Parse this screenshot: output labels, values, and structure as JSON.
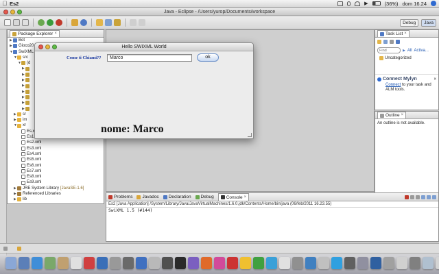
{
  "menubar": {
    "app_name": "Es2",
    "battery_text": "(36%)",
    "clock": "dom 16.24"
  },
  "window": {
    "title": "Java - Eclipse - /Users/yurop/Documents/workspace"
  },
  "toolbar": {
    "perspectives": [
      "Debug",
      "Java"
    ]
  },
  "package_explorer": {
    "tab": "Package Explorer",
    "tree": [
      {
        "indent": 0,
        "label": "Bot",
        "icon": "project",
        "twisty": "right"
      },
      {
        "indent": 0,
        "label": "Gioco20",
        "icon": "project",
        "twisty": "right"
      },
      {
        "indent": 0,
        "label": "SwiXML",
        "icon": "project",
        "twisty": "down"
      },
      {
        "indent": 1,
        "label": "src",
        "icon": "folder",
        "twisty": "down"
      },
      {
        "indent": 2,
        "label": "(d",
        "icon": "package",
        "twisty": "down"
      },
      {
        "indent": 3,
        "label": "",
        "icon": "package",
        "twisty": "right"
      },
      {
        "indent": 3,
        "label": "",
        "icon": "package",
        "twisty": "right"
      },
      {
        "indent": 3,
        "label": "",
        "icon": "package",
        "twisty": "right"
      },
      {
        "indent": 3,
        "label": "",
        "icon": "package",
        "twisty": "right"
      },
      {
        "indent": 3,
        "label": "",
        "icon": "package",
        "twisty": "right"
      },
      {
        "indent": 3,
        "label": "",
        "icon": "package",
        "twisty": "right"
      },
      {
        "indent": 3,
        "label": "",
        "icon": "package",
        "twisty": "right"
      },
      {
        "indent": 3,
        "label": "",
        "icon": "package",
        "twisty": "right"
      },
      {
        "indent": 1,
        "label": "sr",
        "icon": "folder",
        "twisty": "right"
      },
      {
        "indent": 1,
        "label": "im",
        "icon": "folder",
        "twisty": "right"
      },
      {
        "indent": 1,
        "label": "xr",
        "icon": "folder",
        "twisty": "down"
      },
      {
        "indent": 2,
        "label": "Es.xml",
        "icon": "xml",
        "twisty": ""
      },
      {
        "indent": 2,
        "label": "Es1.xml",
        "icon": "xml",
        "twisty": ""
      },
      {
        "indent": 2,
        "label": "Es2.xml",
        "icon": "xml",
        "twisty": ""
      },
      {
        "indent": 2,
        "label": "Es3.xml",
        "icon": "xml",
        "twisty": ""
      },
      {
        "indent": 2,
        "label": "Es4.xml",
        "icon": "xml",
        "twisty": ""
      },
      {
        "indent": 2,
        "label": "Es5.xml",
        "icon": "xml",
        "twisty": ""
      },
      {
        "indent": 2,
        "label": "Es6.xml",
        "icon": "xml",
        "twisty": ""
      },
      {
        "indent": 2,
        "label": "Es7.xml",
        "icon": "xml",
        "twisty": ""
      },
      {
        "indent": 2,
        "label": "Es8.xml",
        "icon": "xml",
        "twisty": ""
      },
      {
        "indent": 2,
        "label": "Es9.xml",
        "icon": "xml",
        "twisty": ""
      },
      {
        "indent": 1,
        "label": "JRE System Library",
        "suffix": "[JavaSE-1.6]",
        "icon": "library",
        "twisty": "right"
      },
      {
        "indent": 1,
        "label": "Referenced Libraries",
        "icon": "library",
        "twisty": "right"
      },
      {
        "indent": 1,
        "label": "lib",
        "icon": "folder",
        "twisty": "right"
      }
    ]
  },
  "task_list": {
    "tab": "Task List",
    "find_placeholder": "Find",
    "filter_all": "All",
    "filter_activate": "Activa...",
    "category": "Uncategorized",
    "mylyn_title": "Connect Mylyn",
    "mylyn_link": "Connect",
    "mylyn_text": "to your task and ALM tools."
  },
  "outline": {
    "tab": "Outline",
    "message": "An outline is not available."
  },
  "console": {
    "tabs": [
      "Problems",
      "Javadoc",
      "Declaration",
      "Debug",
      "Console"
    ],
    "active_tab": "Console",
    "header": "Es2 [Java Application] /System/Library/Java/JavaVirtualMachines/1.6.0.jdk/Contents/Home/bin/java (06/feb/2011 16.23.55)",
    "output": "SwiXML 1.5 (#144)"
  },
  "dialog": {
    "title": "Hello SWIXML World",
    "label": "Come ti Chiami??",
    "input_value": "Marco",
    "button": "ok",
    "result": "nome:  Marco"
  },
  "colors": {
    "dialog_label": "#1c3aa0",
    "selection": "#cfdcf0"
  }
}
